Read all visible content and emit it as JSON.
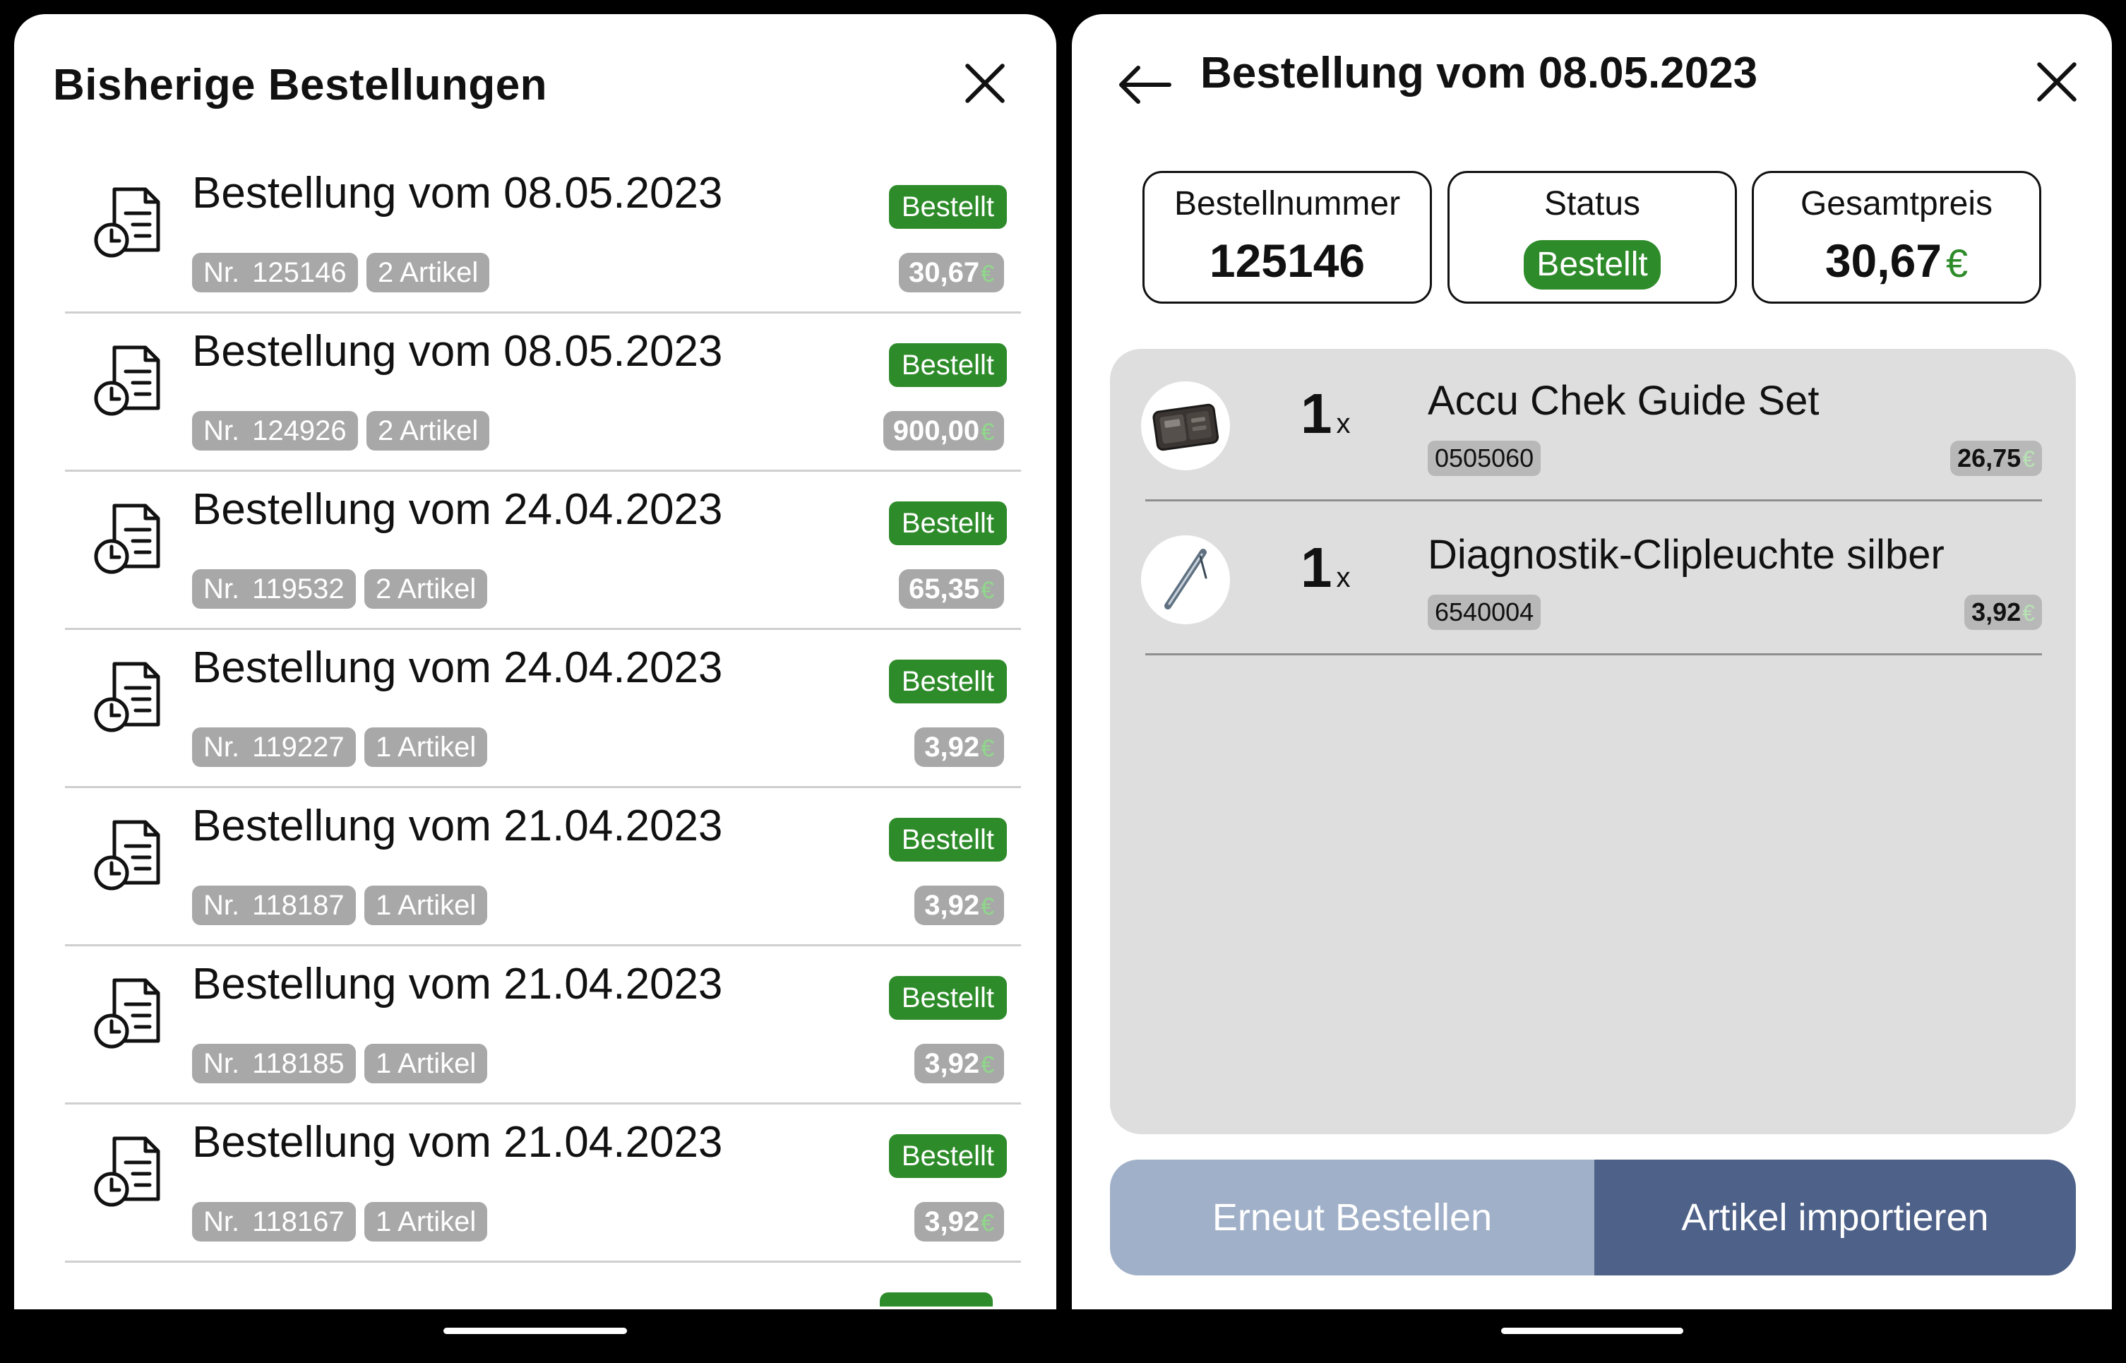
{
  "left": {
    "title": "Bisherige Bestellungen",
    "orders": [
      {
        "title": "Bestellung vom 08.05.2023",
        "status": "Bestellt",
        "nr_prefix": "Nr.",
        "nr": "125146",
        "count": "2 Artikel",
        "price": "30,67",
        "currency": "€"
      },
      {
        "title": "Bestellung vom 08.05.2023",
        "status": "Bestellt",
        "nr_prefix": "Nr.",
        "nr": "124926",
        "count": "2 Artikel",
        "price": "900,00",
        "currency": "€"
      },
      {
        "title": "Bestellung vom 24.04.2023",
        "status": "Bestellt",
        "nr_prefix": "Nr.",
        "nr": "119532",
        "count": "2 Artikel",
        "price": "65,35",
        "currency": "€"
      },
      {
        "title": "Bestellung vom 24.04.2023",
        "status": "Bestellt",
        "nr_prefix": "Nr.",
        "nr": "119227",
        "count": "1 Artikel",
        "price": "3,92",
        "currency": "€"
      },
      {
        "title": "Bestellung vom 21.04.2023",
        "status": "Bestellt",
        "nr_prefix": "Nr.",
        "nr": "118187",
        "count": "1 Artikel",
        "price": "3,92",
        "currency": "€"
      },
      {
        "title": "Bestellung vom 21.04.2023",
        "status": "Bestellt",
        "nr_prefix": "Nr.",
        "nr": "118185",
        "count": "1 Artikel",
        "price": "3,92",
        "currency": "€"
      },
      {
        "title": "Bestellung vom 21.04.2023",
        "status": "Bestellt",
        "nr_prefix": "Nr.",
        "nr": "118167",
        "count": "1 Artikel",
        "price": "3,92",
        "currency": "€"
      }
    ]
  },
  "right": {
    "title": "Bestellung vom 08.05.2023",
    "cards": {
      "number_label": "Bestellnummer",
      "number_value": "125146",
      "status_label": "Status",
      "status_value": "Bestellt",
      "total_label": "Gesamtpreis",
      "total_value": "30,67",
      "currency": "€"
    },
    "items": [
      {
        "qty": "1",
        "x": "x",
        "name": "Accu Chek Guide Set",
        "sku": "0505060",
        "price": "26,75",
        "currency": "€",
        "thumb_icon": "case-icon"
      },
      {
        "qty": "1",
        "x": "x",
        "name": "Diagnostik-Clipleuchte silber",
        "sku": "6540004",
        "price": "3,92",
        "currency": "€",
        "thumb_icon": "penlight-icon"
      }
    ],
    "buttons": {
      "reorder": "Erneut Bestellen",
      "import": "Artikel importieren"
    }
  },
  "colors": {
    "status_green": "#2e8b2a",
    "pill_grey": "#a8a8a8",
    "reorder_button": "#a0b0c8",
    "import_button": "#4e6189"
  }
}
